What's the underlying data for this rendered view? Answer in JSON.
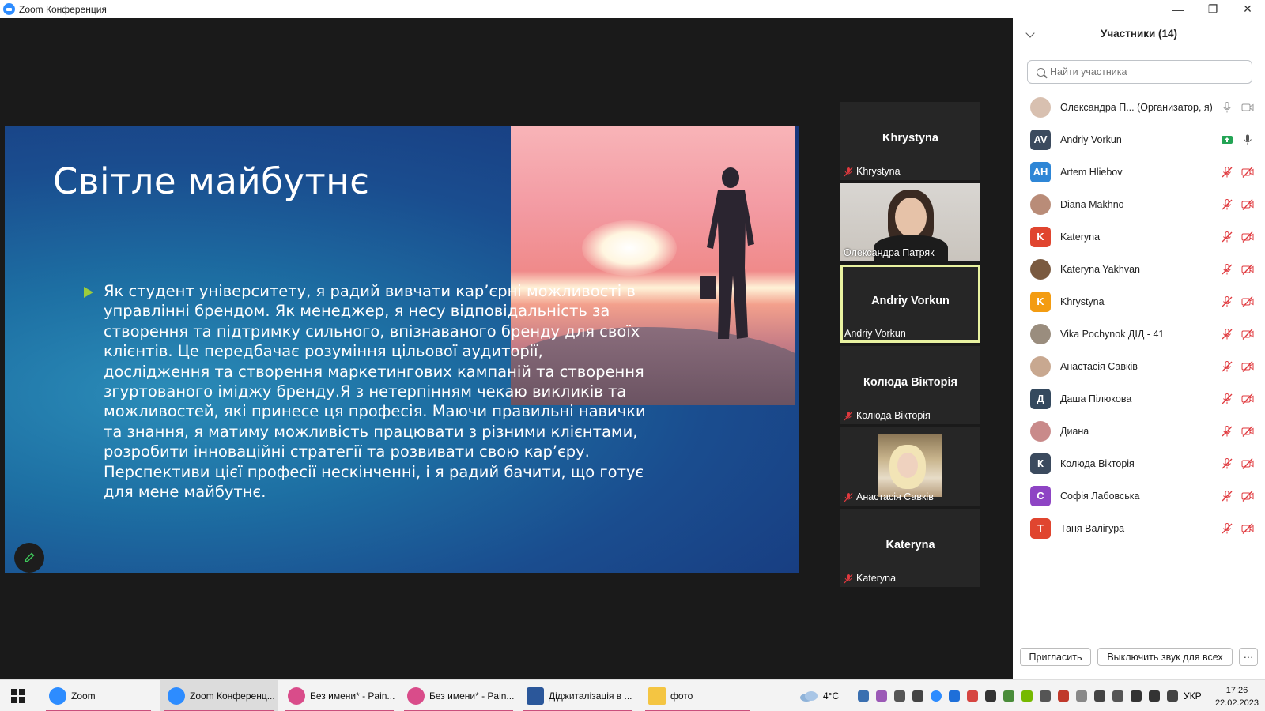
{
  "window": {
    "title": "Zoom Конференция",
    "controls": [
      "—",
      "❐",
      "✕"
    ]
  },
  "slide": {
    "title": "Світле майбутнє",
    "body": "Як студент університету, я радий вивчати кар’єрні можливості  в управлінні брендом. Як менеджер, я несу відповідальність за створення та підтримку сильного, впізнаваного бренду для своїх клієнтів. Це передбачає розуміння цільової аудиторії, дослідження та створення маркетингових кампаній та створення згуртованого іміджу бренду.Я з нетерпінням чекаю викликів та можливостей, які принесе ця професія. Маючи правильні навички та знання, я матиму можливість працювати з різними клієнтами, розробити інноваційні стратегії та розвивати свою кар’єру. Перспективи цієї професії нескінченні, і я радий бачити, що готує для мене майбутнє."
  },
  "tiles": [
    {
      "big": "Khrystyna",
      "small": "Khrystyna",
      "muted": true
    },
    {
      "big": "",
      "small": "Олександра Патряк",
      "muted": false
    },
    {
      "big": "Andriy Vorkun",
      "small": "Andriy Vorkun",
      "muted": false
    },
    {
      "big": "Колюда Вікторія",
      "small": "Колюда Вікторія",
      "muted": true
    },
    {
      "big": "",
      "small": "Анастасія Савків",
      "muted": true
    },
    {
      "big": "Kateryna",
      "small": "Kateryna",
      "muted": true
    }
  ],
  "panel": {
    "title": "Участники (14)",
    "search_placeholder": "Найти участника",
    "invite_label": "Пригласить",
    "mute_all_label": "Выключить звук для всех",
    "more_label": "···"
  },
  "participants": [
    {
      "initials": "",
      "name": "Олександра П... (Организатор, я)",
      "color": "#d8c0b0",
      "photo": true
    },
    {
      "initials": "AV",
      "name": "Andriy Vorkun",
      "color": "#3b4a5e",
      "photo": false
    },
    {
      "initials": "AH",
      "name": "Artem Hliebov",
      "color": "#2e86d6",
      "photo": false
    },
    {
      "initials": "",
      "name": "Diana Makhno",
      "color": "#b98c78",
      "photo": true
    },
    {
      "initials": "K",
      "name": "Kateryna",
      "color": "#e0452f",
      "photo": false
    },
    {
      "initials": "",
      "name": "Kateryna Yakhvan",
      "color": "#7a5a40",
      "photo": true
    },
    {
      "initials": "K",
      "name": "Khrystyna",
      "color": "#f39c12",
      "photo": false
    },
    {
      "initials": "",
      "name": "Vika Pochynok ДІД - 41",
      "color": "#9a8d7e",
      "photo": true
    },
    {
      "initials": "",
      "name": "Анастасія Савків",
      "color": "#c8a890",
      "photo": true
    },
    {
      "initials": "Д",
      "name": "Даша Пілюкова",
      "color": "#34495e",
      "photo": false
    },
    {
      "initials": "",
      "name": "Диана",
      "color": "#c98a8a",
      "photo": true
    },
    {
      "initials": "К",
      "name": "Колюда Вікторія",
      "color": "#3b4a5e",
      "photo": false
    },
    {
      "initials": "С",
      "name": "Софія Лабовська",
      "color": "#8e44c4",
      "photo": false
    },
    {
      "initials": "Т",
      "name": "Таня Валігура",
      "color": "#e0452f",
      "photo": false
    }
  ],
  "taskbar": {
    "items": [
      {
        "label": "Zoom",
        "color": "#2d8cff"
      },
      {
        "label": "Zoom Конференц...",
        "color": "#2d8cff"
      },
      {
        "label": "Без имени* - Pain...",
        "color": "#d94c8a"
      },
      {
        "label": "Без имени* - Pain...",
        "color": "#d94c8a"
      },
      {
        "label": "Діджиталізація в ...",
        "color": "#2b579a"
      },
      {
        "label": "фото",
        "color": "#f4c542"
      }
    ],
    "weather": "4°C",
    "lang": "УКР",
    "time": "17:26",
    "date": "22.02.2023"
  }
}
